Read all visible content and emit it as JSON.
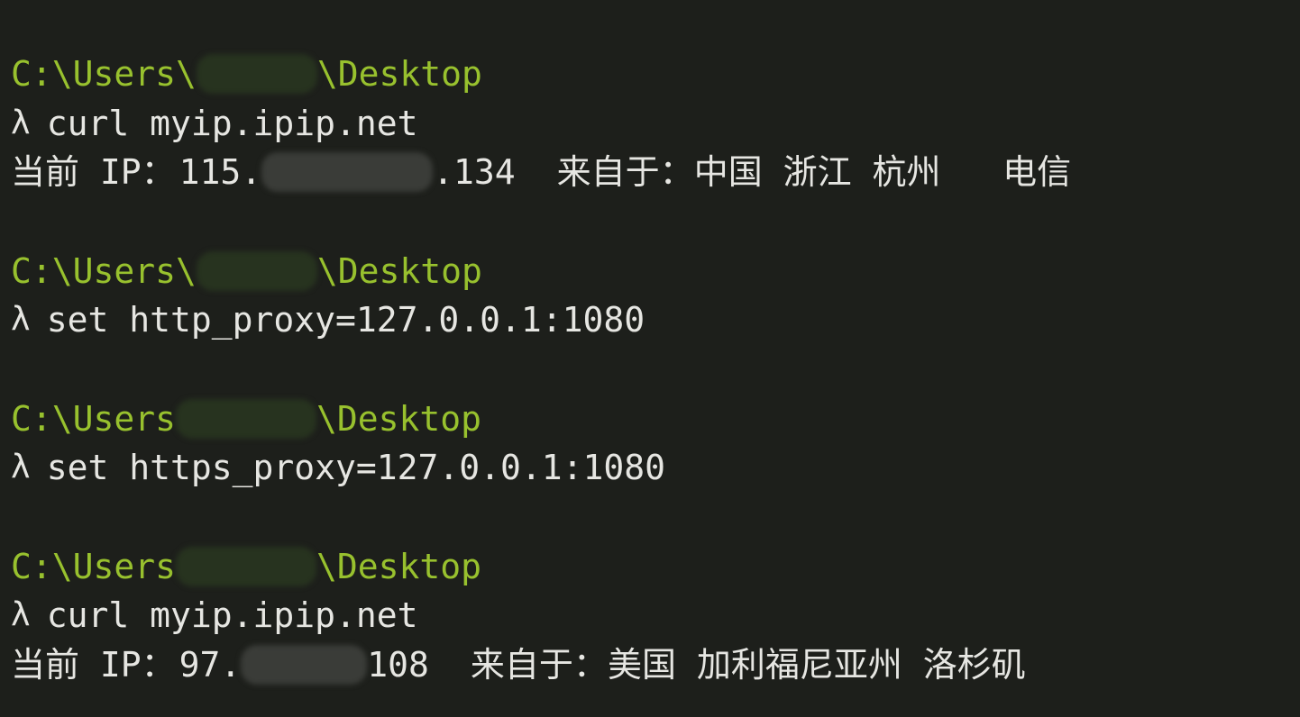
{
  "session": [
    {
      "prompt": {
        "prefix": "C:\\Users\\",
        "suffix": "\\Desktop"
      },
      "command": {
        "symbol": "λ",
        "text": "curl myip.ipip.net"
      },
      "output": {
        "ip_label": "当前 IP：",
        "ip_start": "115.",
        "ip_end": ".134",
        "from_label": "来自于：",
        "location": "中国 浙江 杭州   电信"
      }
    },
    {
      "prompt": {
        "prefix": "C:\\Users\\",
        "suffix": "\\Desktop"
      },
      "command": {
        "symbol": "λ",
        "text": "set http_proxy=127.0.0.1:1080"
      }
    },
    {
      "prompt": {
        "prefix": "C:\\Users",
        "suffix": "\\Desktop"
      },
      "command": {
        "symbol": "λ",
        "text": "set https_proxy=127.0.0.1:1080"
      }
    },
    {
      "prompt": {
        "prefix": "C:\\Users",
        "suffix": "\\Desktop"
      },
      "command": {
        "symbol": "λ",
        "text": "curl myip.ipip.net"
      },
      "output": {
        "ip_label": "当前 IP：",
        "ip_start": "97.",
        "ip_end": "108",
        "from_label": "来自于：",
        "location": "美国 加利福尼亚州 洛杉矶"
      }
    }
  ],
  "colors": {
    "background": "#1d1f1b",
    "prompt": "#98c12e",
    "text": "#e6e6e2"
  }
}
